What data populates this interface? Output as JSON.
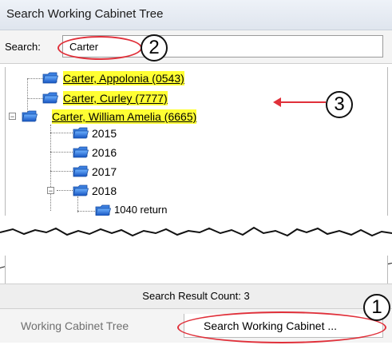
{
  "window": {
    "title": "Search Working Cabinet Tree"
  },
  "search": {
    "label": "Search:",
    "value": "Carter"
  },
  "tree": {
    "results": [
      {
        "label": "Carter, Appolonia (0543)"
      },
      {
        "label": "Carter, Curley (7777)"
      },
      {
        "label": "Carter, William  Amelia (6665)",
        "years": [
          "2015",
          "2016",
          "2017",
          "2018"
        ],
        "subitem": "1040 return"
      }
    ]
  },
  "status": {
    "count_text": "Search Result Count: 3"
  },
  "tabs": [
    {
      "label": "Working Cabinet Tree"
    },
    {
      "label": "Search Working Cabinet ..."
    }
  ],
  "annotations": {
    "one": "1",
    "two": "2",
    "three": "3"
  },
  "colors": {
    "highlight": "#ffff33",
    "annotation": "#e0303a",
    "folder": "#1f6fd1"
  }
}
